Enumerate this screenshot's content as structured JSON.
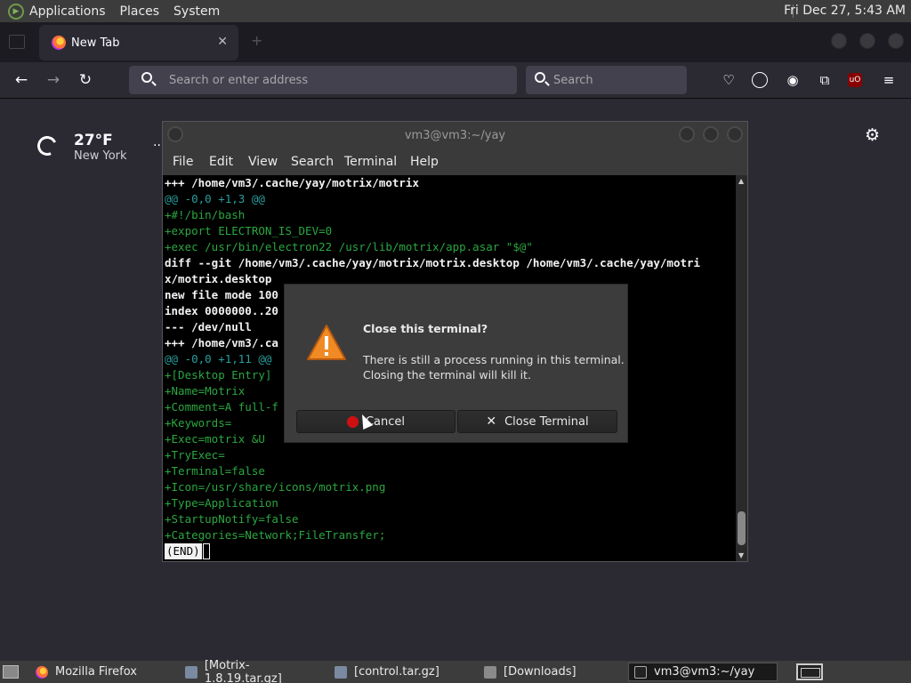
{
  "top_panel": {
    "menus": [
      "Applications",
      "Places",
      "System"
    ],
    "clock": "Fri Dec 27,  5:43 AM"
  },
  "browser": {
    "tab_label": "New Tab",
    "tab_close": "✕",
    "url_placeholder": "Search or enter address",
    "search_placeholder": "Search"
  },
  "newtab": {
    "temperature": "27°F",
    "city": "New York",
    "more": "..."
  },
  "terminal": {
    "title": "vm3@vm3:~/yay",
    "menu": [
      "File",
      "Edit",
      "View",
      "Search",
      "Terminal",
      "Help"
    ],
    "lines": [
      {
        "text": "+++ /home/vm3/.cache/yay/motrix/motrix",
        "style": "w"
      },
      {
        "text": "@@ -0,0 +1,3 @@",
        "style": "c"
      },
      {
        "text": "+#!/bin/bash",
        "style": "g"
      },
      {
        "text": "+export ELECTRON_IS_DEV=0",
        "style": "g"
      },
      {
        "text": "+exec /usr/bin/electron22 /usr/lib/motrix/app.asar \"$@\"",
        "style": "g"
      },
      {
        "text": "diff --git /home/vm3/.cache/yay/motrix/motrix.desktop /home/vm3/.cache/yay/motri",
        "style": "w"
      },
      {
        "text": "x/motrix.desktop",
        "style": "w"
      },
      {
        "text": "new file mode 100",
        "style": "w"
      },
      {
        "text": "index 0000000..20",
        "style": "w"
      },
      {
        "text": "--- /dev/null",
        "style": "w"
      },
      {
        "text": "+++ /home/vm3/.ca",
        "style": "w"
      },
      {
        "text": "@@ -0,0 +1,11 @@",
        "style": "c"
      },
      {
        "text": "+[Desktop Entry]",
        "style": "g"
      },
      {
        "text": "+Name=Motrix",
        "style": "g"
      },
      {
        "text": "+Comment=A full-f",
        "style": "g"
      },
      {
        "text": "+Keywords=",
        "style": "g"
      },
      {
        "text": "+Exec=motrix &U",
        "style": "g"
      },
      {
        "text": "+TryExec=",
        "style": "g"
      },
      {
        "text": "+Terminal=false",
        "style": "g"
      },
      {
        "text": "+Icon=/usr/share/icons/motrix.png",
        "style": "g"
      },
      {
        "text": "+Type=Application",
        "style": "g"
      },
      {
        "text": "+StartupNotify=false",
        "style": "g"
      },
      {
        "text": "+Categories=Network;FileTransfer;",
        "style": "g"
      }
    ],
    "end_marker": "(END)"
  },
  "dialog": {
    "heading": "Close this terminal?",
    "body_line1": "There is still a process running in this terminal.",
    "body_line2": "Closing the terminal will kill it.",
    "cancel_label": "Cancel",
    "close_label": "Close Terminal"
  },
  "taskbar": {
    "items": [
      {
        "label": "Mozilla Firefox",
        "icon": "firefox-icon"
      },
      {
        "label": "[Motrix-1.8.19.tar.gz]",
        "icon": "archive-icon"
      },
      {
        "label": "[control.tar.gz]",
        "icon": "archive-icon"
      },
      {
        "label": "[Downloads]",
        "icon": "folder-icon"
      },
      {
        "label": "vm3@vm3:~/yay",
        "icon": "terminal-icon"
      }
    ]
  },
  "colors": {
    "terminal_bold": "#f2f2f2",
    "terminal_hunk": "#2a9d9d",
    "terminal_added": "#2ba640",
    "warning": "#f08a24"
  }
}
